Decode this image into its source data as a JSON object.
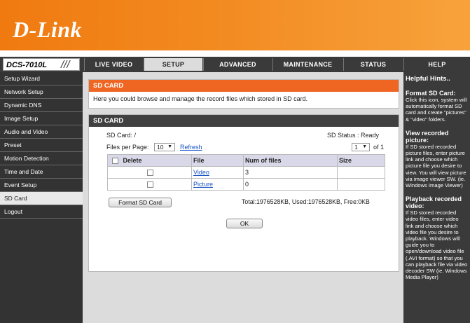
{
  "brand": {
    "logo": "D-Link"
  },
  "nav": {
    "model": "DCS-7010L",
    "slash": "///",
    "tabs": [
      {
        "label": "LIVE VIDEO"
      },
      {
        "label": "SETUP"
      },
      {
        "label": "ADVANCED"
      },
      {
        "label": "MAINTENANCE"
      },
      {
        "label": "STATUS"
      },
      {
        "label": "HELP"
      }
    ]
  },
  "sidebar": {
    "items": [
      {
        "label": "Setup Wizard"
      },
      {
        "label": "Network Setup"
      },
      {
        "label": "Dynamic DNS"
      },
      {
        "label": "Image Setup"
      },
      {
        "label": "Audio and Video"
      },
      {
        "label": "Preset"
      },
      {
        "label": "Motion Detection"
      },
      {
        "label": "Time and Date"
      },
      {
        "label": "Event Setup"
      },
      {
        "label": "SD Card"
      },
      {
        "label": "Logout"
      }
    ]
  },
  "intro": {
    "title": "SD CARD",
    "text": "Here you could browse and manage the record files which stored in SD card."
  },
  "sdcard": {
    "title": "SD CARD",
    "path_label": "SD Card: /",
    "status_label": "SD Status : Ready",
    "files_per_page_label": "Files per Page:",
    "files_per_page_value": "10",
    "refresh_label": "Refresh",
    "page_value": "1",
    "page_of": "of 1",
    "columns": {
      "delete": "Delete",
      "file": "File",
      "num": "Num of files",
      "size": "Size"
    },
    "rows": [
      {
        "file": "Video",
        "num": "3",
        "size": ""
      },
      {
        "file": "Picture",
        "num": "0",
        "size": ""
      }
    ],
    "format_button": "Format SD Card",
    "summary": "Total:1976528KB, Used:1976528KB, Free:0KB",
    "ok_button": "OK"
  },
  "hints": {
    "title": "Helpful Hints..",
    "sections": [
      {
        "heading": "Format SD Card:",
        "body": "Click this icon, system will automatically format SD card and create \"pictures\" & \"video\" folders."
      },
      {
        "heading": "View recorded picture:",
        "body": "If SD stored recorded picture files, enter picture link and choose which picture file you desire to view. You will view picture via image viewer SW. (ie. Windows Image Viewer)"
      },
      {
        "heading": "Playback recorded video:",
        "body": "If SD stored recorded video files, enter video link and choose which video file you desire to playback. Windows will guide you to open/download video file (.AVI format) so that you can playback file via video decoder SW (ie. Windows Media Player)"
      }
    ]
  },
  "colors": {
    "brand_orange": "#f07a10",
    "section_orange": "#ee6622",
    "dark": "#333333"
  }
}
